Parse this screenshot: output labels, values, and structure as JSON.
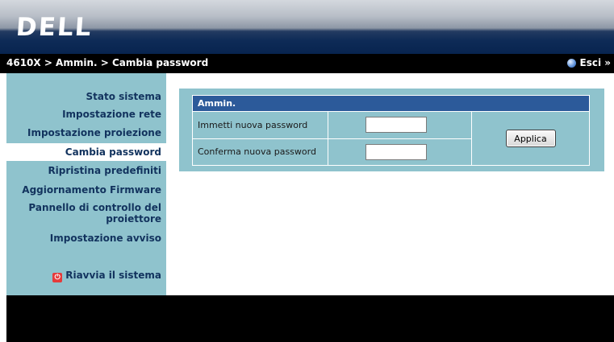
{
  "brand": {
    "logo": "DELL"
  },
  "breadcrumb": "4610X > Ammin. > Cambia password",
  "exit_label": "Esci »",
  "sidebar": {
    "items": [
      {
        "label": "Stato sistema"
      },
      {
        "label": "Impostazione rete"
      },
      {
        "label": "Impostazione proiezione"
      },
      {
        "label": "Cambia password"
      },
      {
        "label": "Ripristina predefiniti"
      },
      {
        "label": "Aggiornamento Firmware"
      },
      {
        "label_line1": "Pannello di controllo del",
        "label_line2": "proiettore"
      },
      {
        "label": "Impostazione avviso"
      }
    ],
    "restart": {
      "label": "Riavvia il sistema",
      "icon": "power-icon"
    }
  },
  "form": {
    "header": "Ammin.",
    "new_password_label": "Immetti nuova password",
    "new_password_value": "",
    "confirm_password_label": "Conferma nuova password",
    "confirm_password_value": "",
    "apply_label": "Applica"
  },
  "colors": {
    "panel_bg": "#8fc3cd",
    "table_header": "#2c5a9a",
    "nav_text": "#12335e"
  }
}
